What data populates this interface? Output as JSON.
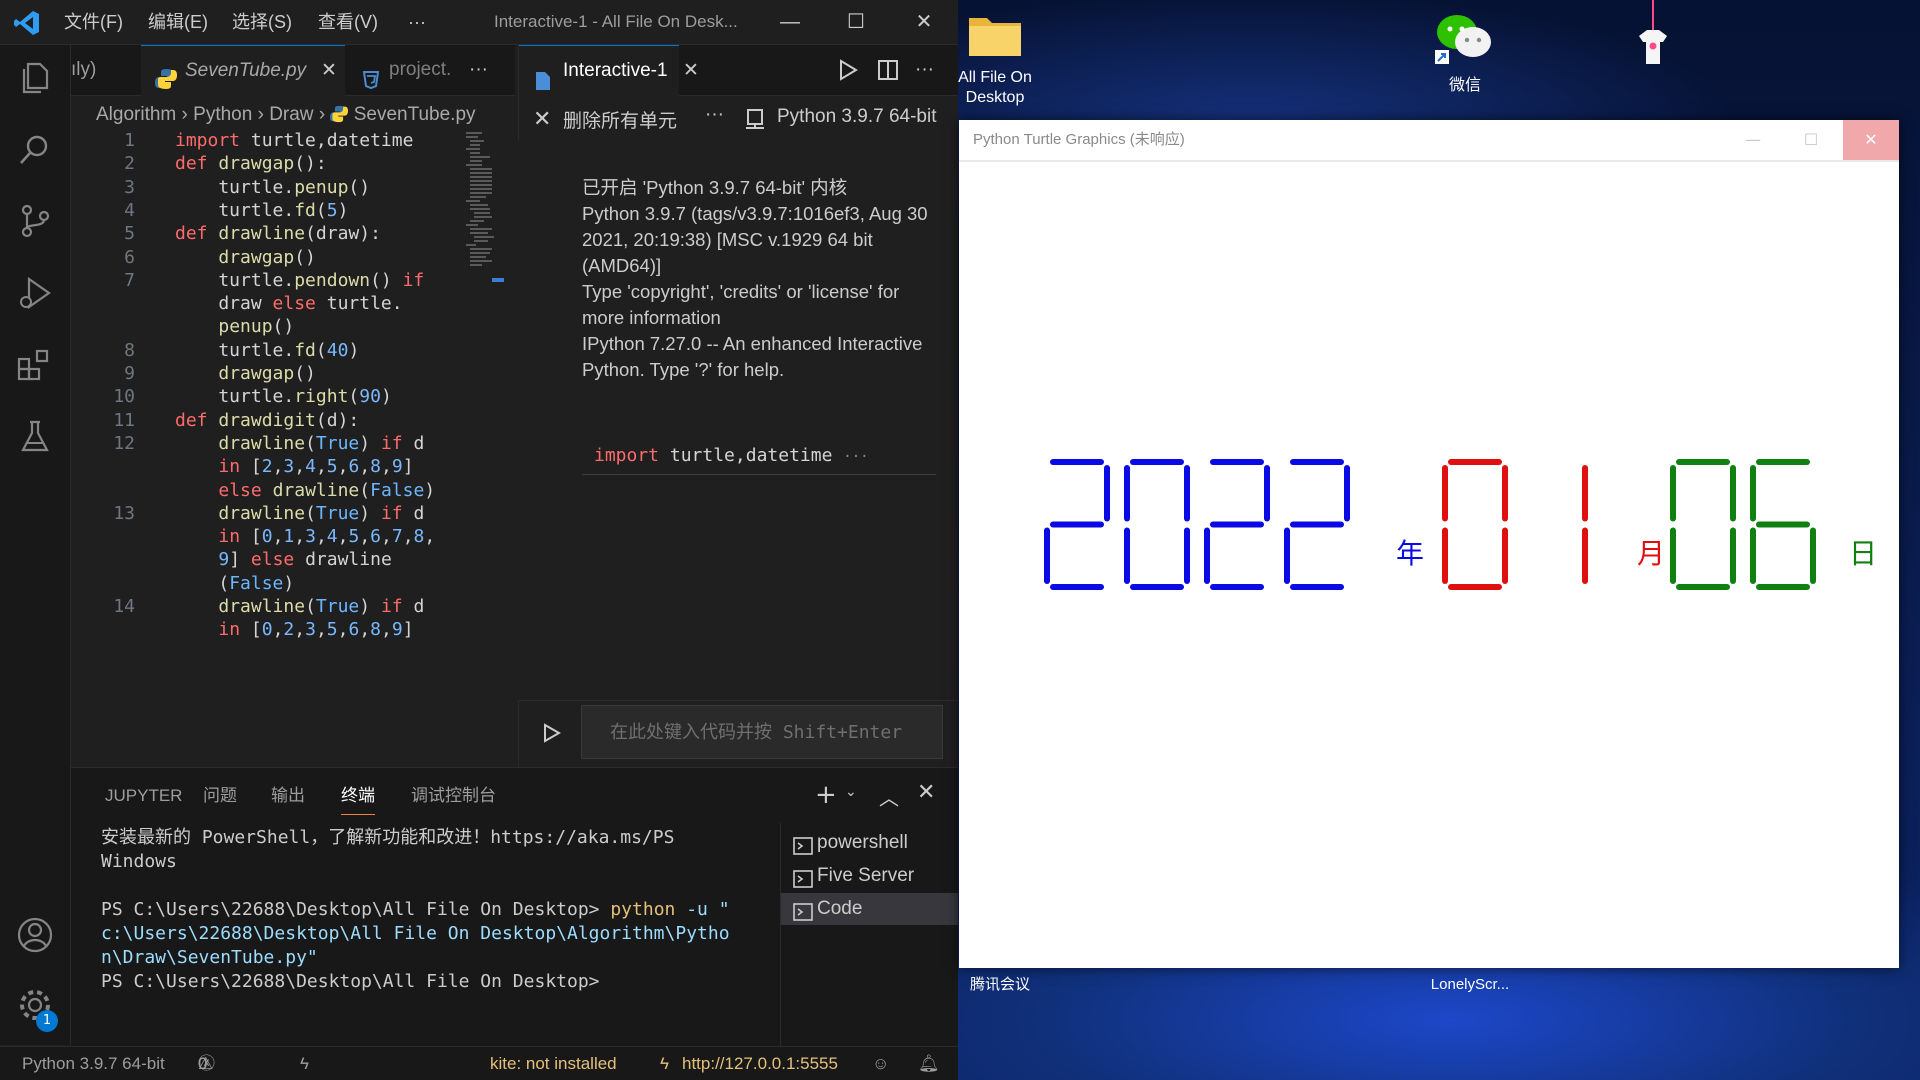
{
  "desktop": {
    "icons": [
      {
        "label": "All File On Desktop",
        "icon": "folder-icon"
      },
      {
        "label": "微信",
        "icon": "wechat-icon"
      },
      {
        "label": "",
        "icon": "tshirt-app-icon"
      },
      {
        "label": "腾讯会议",
        "icon": "app-icon"
      },
      {
        "label": "LonelyScr...",
        "icon": "app-icon"
      }
    ]
  },
  "vscode": {
    "menu": [
      "文件(F)",
      "编辑(E)",
      "选择(S)",
      "查看(V)",
      "···"
    ],
    "window_title": "Interactive-1 - All File On Desk...",
    "window_buttons": [
      "—",
      "☐",
      "✕"
    ],
    "tabs_left": [
      {
        "label": "ıly)",
        "active": false
      },
      {
        "label": "SevenTube.py",
        "active": true,
        "close": "✕"
      },
      {
        "label": "project.",
        "active": false
      }
    ],
    "tabs_left_more": "···",
    "breadcrumb": [
      "Algorithm",
      "Python",
      "Draw",
      "SevenTube.py"
    ],
    "breadcrumb_sep": "›",
    "code_lines": [
      {
        "n": "1",
        "html": "<span class='kw'>import</span> turtle,datetime"
      },
      {
        "n": "2",
        "html": "<span class='kw'>def</span> <span class='fn'>drawgap</span>():"
      },
      {
        "n": "3",
        "html": "    turtle.<span class='fn'>penup</span>()"
      },
      {
        "n": "4",
        "html": "    turtle.<span class='fn'>fd</span>(<span class='nm'>5</span>)"
      },
      {
        "n": "5",
        "html": "<span class='kw'>def</span> <span class='fn'>drawline</span>(draw):"
      },
      {
        "n": "6",
        "html": "    <span class='fn'>drawgap</span>()"
      },
      {
        "n": "7",
        "html": "    turtle.<span class='fn'>pendown</span>() <span class='kw'>if</span>"
      },
      {
        "n": "",
        "html": "    draw <span class='kw'>else</span> turtle."
      },
      {
        "n": "",
        "html": "    <span class='fn'>penup</span>()"
      },
      {
        "n": "8",
        "html": "    turtle.<span class='fn'>fd</span>(<span class='nm'>40</span>)"
      },
      {
        "n": "9",
        "html": "    <span class='fn'>drawgap</span>()"
      },
      {
        "n": "10",
        "html": "    turtle.<span class='fn'>right</span>(<span class='nm'>90</span>)"
      },
      {
        "n": "11",
        "html": "<span class='kw'>def</span> <span class='fn'>drawdigit</span>(d):"
      },
      {
        "n": "12",
        "html": "    <span class='fn'>drawline</span>(<span class='bl'>True</span>) <span class='kw'>if</span> d"
      },
      {
        "n": "",
        "html": "    <span class='kw'>in</span> [<span class='nm'>2</span>,<span class='nm'>3</span>,<span class='nm'>4</span>,<span class='nm'>5</span>,<span class='nm'>6</span>,<span class='nm'>8</span>,<span class='nm'>9</span>]"
      },
      {
        "n": "",
        "html": "    <span class='kw'>else</span> <span class='fn'>drawline</span>(<span class='bl'>False</span>)"
      },
      {
        "n": "13",
        "html": "    <span class='fn'>drawline</span>(<span class='bl'>True</span>) <span class='kw'>if</span> d"
      },
      {
        "n": "",
        "html": "    <span class='kw'>in</span> [<span class='nm'>0</span>,<span class='nm'>1</span>,<span class='nm'>3</span>,<span class='nm'>4</span>,<span class='nm'>5</span>,<span class='nm'>6</span>,<span class='nm'>7</span>,<span class='nm'>8</span>,"
      },
      {
        "n": "",
        "html": "    <span class='nm'>9</span>] <span class='kw'>else</span> drawline"
      },
      {
        "n": "",
        "html": "    (<span class='bl'>False</span>)"
      },
      {
        "n": "14",
        "html": "    <span class='fn'>drawline</span>(<span class='bl'>True</span>) <span class='kw'>if</span> d"
      },
      {
        "n": "",
        "html": "    <span class='kw'>in</span> [<span class='nm'>0</span>,<span class='nm'>2</span>,<span class='nm'>3</span>,<span class='nm'>5</span>,<span class='nm'>6</span>,<span class='nm'>8</span>,<span class='nm'>9</span>]"
      }
    ],
    "interactive": {
      "tab_label": "Interactive-1",
      "tab_close": "✕",
      "clear_label": "删除所有单元",
      "toolbar_more": "···",
      "kernel_label": "Python 3.9.7 64-bit",
      "output_lines": [
        "已开启 'Python 3.9.7 64-bit' 内核",
        "Python 3.9.7 (tags/v3.9.7:1016ef3, Aug 30",
        "2021, 20:19:38) [MSC v.1929 64 bit",
        "(AMD64)]",
        "Type 'copyright', 'credits' or 'license' for",
        "more information",
        "IPython 7.27.0 -- An enhanced Interactive",
        "Python. Type '?' for help."
      ],
      "cell_keyword": "import",
      "cell_rest": " turtle,datetime",
      "cell_more": "···",
      "input_placeholder": "在此处键入代码并按 Shift+Enter"
    },
    "panel": {
      "tabs": [
        "JUPYTER",
        "问题",
        "输出",
        "终端",
        "调试控制台"
      ],
      "active_tab": "终端",
      "terminal_lines": [
        {
          "text": "安装最新的 PowerShell，了解新功能和改进！https://aka.ms/PS"
        },
        {
          "text": "Windows"
        },
        {
          "text": ""
        },
        {
          "prompt": "PS C:\\Users\\22688\\Desktop\\All File On Desktop> ",
          "cmd": "python",
          "rest": " -u \""
        },
        {
          "path": "c:\\Users\\22688\\Desktop\\All File On Desktop\\Algorithm\\Pytho"
        },
        {
          "path": "n\\Draw\\SevenTube.py\""
        },
        {
          "text": "PS C:\\Users\\22688\\Desktop\\All File On Desktop>"
        }
      ],
      "terminals": [
        "powershell",
        "Five Server",
        "Code"
      ],
      "selected_terminal": "Code"
    },
    "status": {
      "interpreter": "Python 3.9.7 64-bit",
      "errors": "0",
      "warnings": "0",
      "kite": "kite: not installed",
      "server": "http://127.0.0.1:5555"
    },
    "notification_badge": "1"
  },
  "turtle_window": {
    "title": "Python Turtle Graphics (未响应)",
    "buttons": [
      "—",
      "☐",
      "✕"
    ],
    "date": {
      "year": "2022",
      "year_label": "年",
      "month": "01",
      "month_label": "月",
      "day": "06",
      "day_label": "日",
      "colors": {
        "year": "#0a0ae6",
        "month": "#e01010",
        "day": "#108010"
      }
    }
  }
}
